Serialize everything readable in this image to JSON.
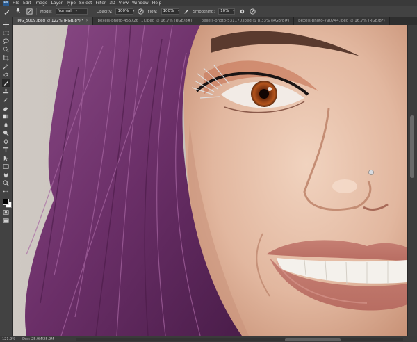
{
  "app": {
    "logo_text": "Ps"
  },
  "menu": {
    "items": [
      "File",
      "Edit",
      "Image",
      "Layer",
      "Type",
      "Select",
      "Filter",
      "3D",
      "View",
      "Window",
      "Help"
    ]
  },
  "options": {
    "brush_size": "25",
    "mode_label": "Mode:",
    "mode_value": "Normal",
    "opacity_label": "Opacity:",
    "opacity_value": "100%",
    "flow_label": "Flow:",
    "flow_value": "100%",
    "smoothing_label": "Smoothing:",
    "smoothing_value": "10%"
  },
  "tabs": [
    {
      "label": "IMG_5009.jpeg @ 122% (RGB/8*) *",
      "active": true
    },
    {
      "label": "pexels-photo-455726 (1).jpeg @ 16.7% (RGB/8#)",
      "active": false
    },
    {
      "label": "pexels-photo-531170.jpeg @ 8.33% (RGB/8#)",
      "active": false
    },
    {
      "label": "pexels-photo-790744.jpeg @ 16.7% (RGB/8*)",
      "active": false
    }
  ],
  "status": {
    "zoom": "121.9%",
    "doc": "Doc: 25.9M/25.9M"
  },
  "colors": {
    "foreground": "#000000",
    "background": "#ffffff",
    "accent": "#2a5b91"
  },
  "tools": [
    "move-icon",
    "marquee-icon",
    "lasso-icon",
    "quick-select-icon",
    "crop-icon",
    "eyedropper-icon",
    "healing-icon",
    "brush-icon",
    "stamp-icon",
    "history-brush-icon",
    "eraser-icon",
    "gradient-icon",
    "blur-icon",
    "dodge-icon",
    "pen-icon",
    "type-icon",
    "path-select-icon",
    "rectangle-icon",
    "hand-icon",
    "zoom-icon",
    "more-icon"
  ]
}
